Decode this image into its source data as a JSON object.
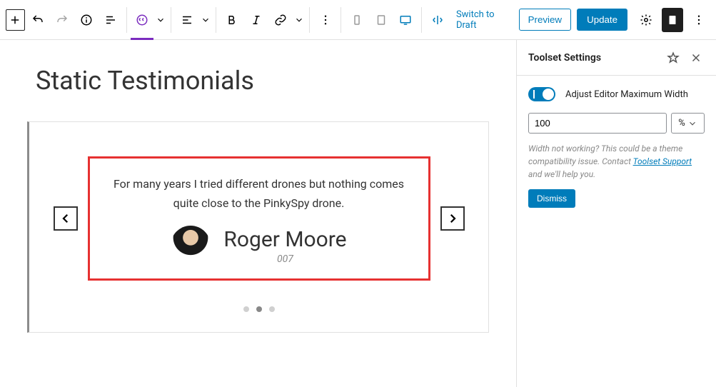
{
  "toolbar": {
    "switch_draft": "Switch to Draft",
    "preview": "Preview",
    "update": "Update"
  },
  "editor": {
    "page_title": "Static Testimonials",
    "testimonial": {
      "quote": "For many years I tried different drones but nothing comes quite close to the PinkySpy drone.",
      "author": "Roger Moore",
      "role": "007"
    },
    "slide_index": 1,
    "slide_count": 3
  },
  "sidebar": {
    "title": "Toolset Settings",
    "toggle_label": "Adjust Editor Maximum Width",
    "toggle_on": true,
    "width_value": "100",
    "width_unit": "%",
    "help_text_1": "Width not working? This could be a theme compatibility issue. Contact ",
    "help_link": "Toolset Support",
    "help_text_2": " and we'll help you.",
    "dismiss": "Dismiss"
  }
}
